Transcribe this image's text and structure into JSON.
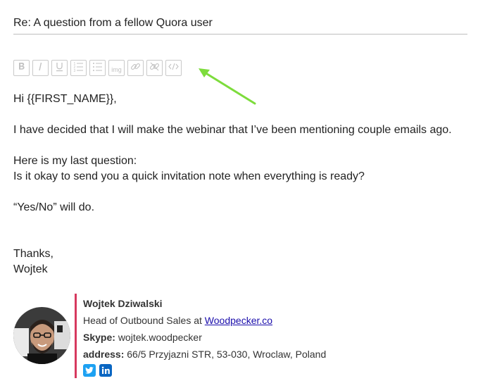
{
  "email": {
    "subject": "Re: A question from a fellow Quora user",
    "greeting": "Hi {{FIRST_NAME}},",
    "paragraph1": "I have decided that I will make the webinar that I’ve been mentioning couple emails ago.",
    "paragraph2_line1": "Here is my last question:",
    "paragraph2_line2": "Is it okay to send you a quick invitation note when everything is ready?",
    "paragraph3": "“Yes/No” will do.",
    "closing": "Thanks,",
    "sender": "Wojtek"
  },
  "toolbar": {
    "buttons": [
      {
        "name": "bold",
        "icon": "bold-icon"
      },
      {
        "name": "italic",
        "icon": "italic-icon"
      },
      {
        "name": "underline",
        "icon": "underline-icon"
      },
      {
        "name": "ordered-list",
        "icon": "ordered-list-icon"
      },
      {
        "name": "unordered-list",
        "icon": "unordered-list-icon"
      },
      {
        "name": "image",
        "icon": "image-icon",
        "label": "img"
      },
      {
        "name": "link",
        "icon": "link-icon"
      },
      {
        "name": "unlink",
        "icon": "unlink-icon"
      },
      {
        "name": "source-code",
        "icon": "code-icon"
      }
    ],
    "arrow_color": "#7ddc3c"
  },
  "signature": {
    "name": "Wojtek Dziwalski",
    "title_prefix": "Head of Outbound Sales at ",
    "company_link": "Woodpecker.co",
    "skype_label": "Skype:",
    "skype_value": "wojtek.woodpecker",
    "address_label": "address:",
    "address_value": "66/5 Przyjazni STR, 53-030, Wroclaw, Poland",
    "accent_color": "#d6395f",
    "social": [
      {
        "name": "twitter",
        "icon": "twitter-icon",
        "color": "#1da1f2"
      },
      {
        "name": "linkedin",
        "icon": "linkedin-icon",
        "color": "#0a66c2"
      }
    ]
  }
}
